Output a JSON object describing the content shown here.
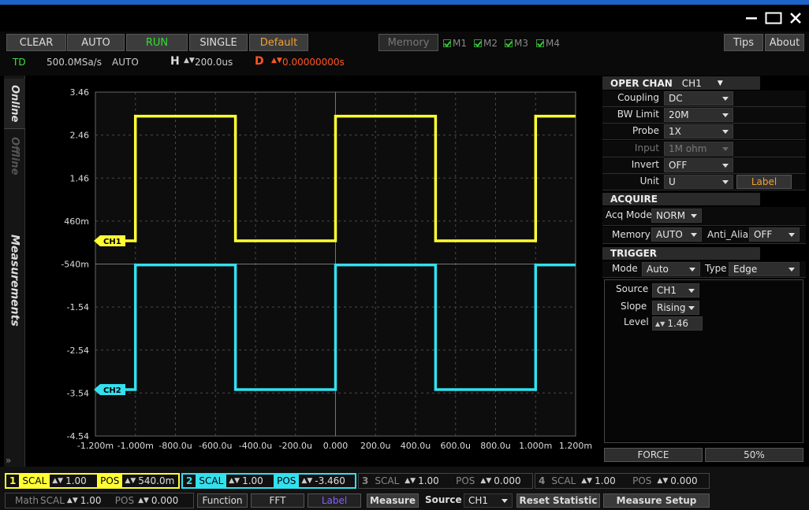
{
  "window": {
    "minimize_icon": "minimize-icon",
    "maximize_icon": "maximize-icon",
    "close_icon": "close-icon"
  },
  "toolbar": {
    "clear": "CLEAR",
    "auto": "AUTO",
    "run": "RUN",
    "single": "SINGLE",
    "default": "Default",
    "memory": "Memory",
    "m1": "M1",
    "m2": "M2",
    "m3": "M3",
    "m4": "M4",
    "tips": "Tips",
    "about": "About",
    "td": "TD",
    "sample_rate": "500.0MSa/s",
    "trig_mode": "AUTO",
    "h_label": "H",
    "h_value": "200.0us",
    "d_label": "D",
    "d_value": "0.00000000s",
    "colors": {
      "run": "#33dd33",
      "default": "#f0a030",
      "delay": "#ff5522"
    }
  },
  "sidebar": {
    "online": "Online",
    "offline": "Offline",
    "measurements": "Measurements"
  },
  "chart_data": {
    "type": "line",
    "xlabel": "",
    "ylabel": "",
    "x_ticks": [
      "-1.200m",
      "-1.000m",
      "-800.0u",
      "-600.0u",
      "-400.0u",
      "-200.0u",
      "0.000",
      "200.0u",
      "400.0u",
      "600.0u",
      "800.0u",
      "1.000m",
      "1.200m"
    ],
    "y_ticks": [
      "3.46",
      "2.46",
      "1.46",
      "460m",
      "-540m",
      "-1.54",
      "-2.54",
      "-3.54",
      "-4.54"
    ],
    "xlim": [
      -0.0012,
      0.0012
    ],
    "ylim": [
      -4.54,
      3.46
    ],
    "grid": true,
    "series": [
      {
        "name": "CH1",
        "color": "#ffff33",
        "x": [
          -0.0012,
          -0.001,
          -0.001,
          -0.0005,
          -0.0005,
          0.0,
          0.0,
          0.0005,
          0.0005,
          0.001,
          0.001,
          0.0012
        ],
        "y": [
          0.0,
          0.0,
          2.9,
          2.9,
          0.0,
          0.0,
          2.9,
          2.9,
          0.0,
          0.0,
          2.9,
          2.9
        ]
      },
      {
        "name": "CH2",
        "color": "#33e0ee",
        "x": [
          -0.0012,
          -0.001,
          -0.001,
          -0.0005,
          -0.0005,
          0.0,
          0.0,
          0.0005,
          0.0005,
          0.001,
          0.001,
          0.0012
        ],
        "y": [
          -3.46,
          -3.46,
          -0.56,
          -0.56,
          -3.46,
          -3.46,
          -0.56,
          -0.56,
          -3.46,
          -3.46,
          -0.56,
          -0.56
        ]
      }
    ]
  },
  "panel": {
    "oper_chan_label": "OPER CHAN",
    "oper_chan_value": "CH1",
    "coupling_label": "Coupling",
    "coupling_value": "DC",
    "bwlimit_label": "BW Limit",
    "bwlimit_value": "20M",
    "probe_label": "Probe",
    "probe_value": "1X",
    "input_label": "Input",
    "input_value": "1M ohm",
    "invert_label": "Invert",
    "invert_value": "OFF",
    "unit_label": "Unit",
    "unit_value": "U",
    "label_button": "Label",
    "acquire_header": "ACQUIRE",
    "acqmode_label": "Acq Mode",
    "acqmode_value": "NORM",
    "memory_label": "Memory",
    "memory_value": "AUTO",
    "antialia_label": "Anti_Alia",
    "antialia_value": "OFF",
    "trigger_header": "TRIGGER",
    "mode_label": "Mode",
    "mode_value": "Auto",
    "type_label": "Type",
    "type_value": "Edge",
    "source_label": "Source",
    "source_value": "CH1",
    "slope_label": "Slope",
    "slope_value": "Rising",
    "level_label": "Level",
    "level_value": "1.46",
    "force_button": "FORCE",
    "fifty_button": "50%"
  },
  "bottom": {
    "ch1": {
      "num": "1",
      "scal": "SCAL",
      "scal_value": "1.00",
      "pos": "POS",
      "pos_value": "540.0m",
      "color": "#ffff33"
    },
    "ch2": {
      "num": "2",
      "scal": "SCAL",
      "scal_value": "1.00",
      "pos": "POS",
      "pos_value": "-3.460",
      "color": "#33e0ee"
    },
    "ch3": {
      "num": "3",
      "scal": "SCAL",
      "scal_value": "1.00",
      "pos": "POS",
      "pos_value": "0.000"
    },
    "ch4": {
      "num": "4",
      "scal": "SCAL",
      "scal_value": "1.00",
      "pos": "POS",
      "pos_value": "0.000"
    },
    "math": "Math",
    "math_scal": "SCAL",
    "math_scal_value": "1.00",
    "math_pos": "POS",
    "math_pos_value": "0.000",
    "function": "Function",
    "fft": "FFT",
    "label": "Label",
    "measure": "Measure",
    "source": "Source",
    "source_value": "CH1",
    "reset_statistic": "Reset  Statistic",
    "measure_setup": "Measure Setup"
  }
}
